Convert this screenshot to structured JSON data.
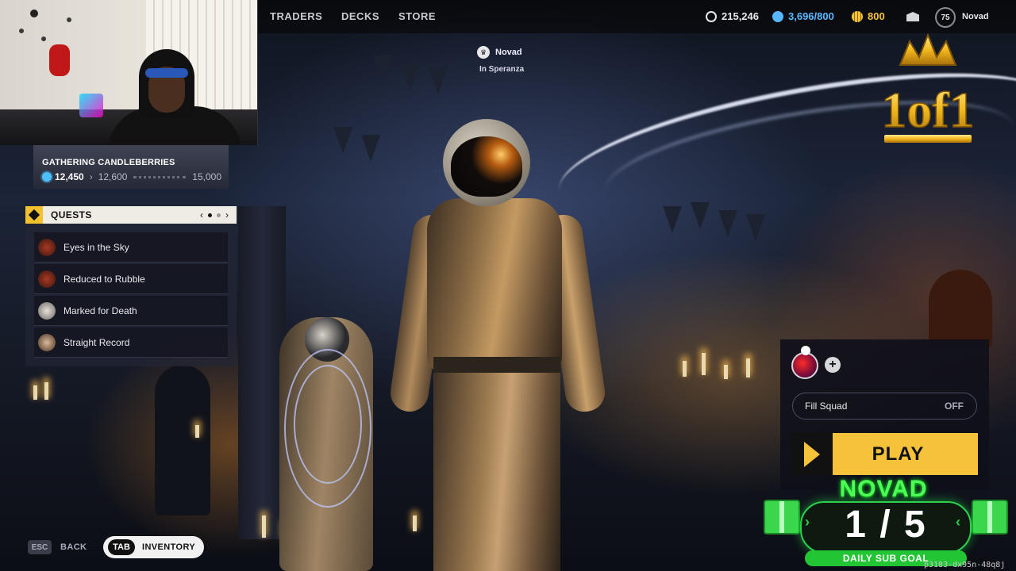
{
  "nav": {
    "links": [
      "TRADERS",
      "DECKS",
      "STORE"
    ],
    "currencies": [
      {
        "value": "215,246",
        "icon": "coin-icon",
        "color": "#e8e8ea"
      },
      {
        "value": "3,696/800",
        "icon": "scrip-icon",
        "color": "#58b8ff"
      },
      {
        "value": "800",
        "icon": "gold-coins-icon",
        "color": "#f5c23a"
      }
    ],
    "level": "75",
    "player_name": "Novad"
  },
  "player_tag": {
    "name": "Novad",
    "location": "In Speranza"
  },
  "season": {
    "title": "GATHERING CANDLEBERRIES",
    "current": "12,450",
    "next": "12,600",
    "max": "15,000"
  },
  "quests": {
    "title": "QUESTS",
    "items": [
      {
        "label": "Eyes in the Sky",
        "avatar_color": "#7a2a1e"
      },
      {
        "label": "Reduced to Rubble",
        "avatar_color": "#7a2a1e"
      },
      {
        "label": "Marked for Death",
        "avatar_color": "#b8b4ac"
      },
      {
        "label": "Straight Record",
        "avatar_color": "#8a6c50"
      }
    ]
  },
  "footer": {
    "esc_key": "ESC",
    "back_label": "BACK",
    "tab_key": "TAB",
    "inventory_label": "INVENTORY"
  },
  "squad": {
    "fill_label": "Fill Squad",
    "fill_value": "OFF",
    "play_label": "PLAY"
  },
  "overlay": {
    "logo_text": "1of1",
    "sub_goal_name": "NOVAD",
    "sub_goal_count": "1 / 5",
    "sub_goal_label": "DAILY SUB GOAL",
    "build_id": "p3183-dx95n-48q8j"
  },
  "colors": {
    "accent": "#f5c23a",
    "subgoal": "#3bd64c"
  }
}
